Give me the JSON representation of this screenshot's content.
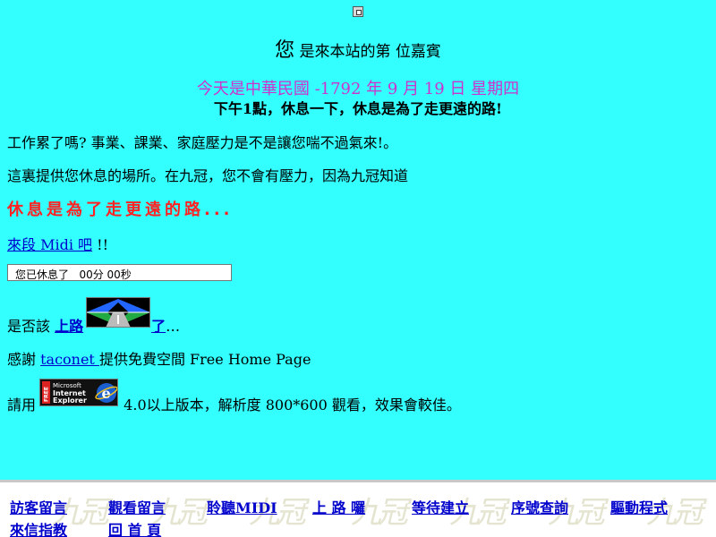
{
  "visitor": {
    "big_char": "您",
    "rest": "是來本站的第 位嘉賓"
  },
  "date_line": "今天是中華民國 -1792 年 9 月 19 日 星期四",
  "greeting": "下午1點，休息一下，休息是為了走更遠的路!",
  "paragraphs": {
    "p1": "工作累了嗎? 事業、課業、家庭壓力是不是讓您喘不過氣來!。",
    "p2": "這裏提供您休息的場所。在九冠，您不會有壓力，因為九冠知道"
  },
  "slogan": "休息是為了走更遠的路...",
  "midi": {
    "link": "來段 Midi 吧",
    "suffix": " !!"
  },
  "timer_text": "您已休息了   00分 00秒",
  "road": {
    "prefix": "是否該 ",
    "link1": "上路",
    "link2": "了",
    "suffix": "…"
  },
  "thanks": {
    "prefix": "感謝 ",
    "link": "taconet ",
    "suffix": "提供免費空間 Free Home Page"
  },
  "browser": {
    "prefix": "請用 ",
    "suffix": " 4.0以上版本，解析度 800*600 觀看，效果會較佳。"
  },
  "ie_badge": {
    "free": "FREE",
    "microsoft": "Microsoft",
    "internet": "Internet",
    "explorer": "Explorer",
    "e": "e"
  },
  "footer": {
    "watermark": "九冠",
    "nav": [
      "訪客留言",
      "觀看留言",
      "聆聽MIDI",
      "上 路 囉",
      "等待建立",
      "序號查詢",
      "驅動程式",
      "來信指教",
      "回 首 頁"
    ]
  },
  "colors": {
    "background": "#33ffff",
    "date": "#cc33cc",
    "slogan": "#ff2222",
    "link": "#0000cc"
  }
}
